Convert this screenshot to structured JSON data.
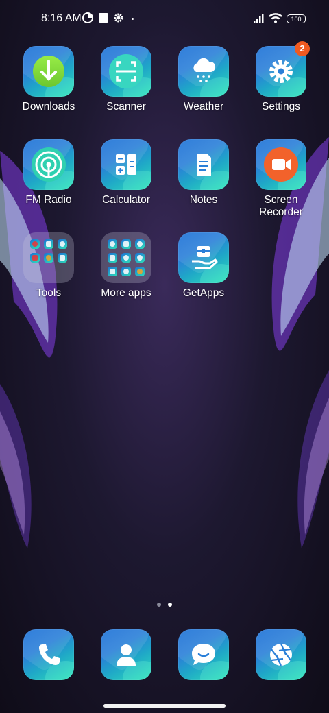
{
  "status_bar": {
    "time": "8:16 AM",
    "battery": "100"
  },
  "apps": [
    {
      "label": "Downloads",
      "icon": "download-icon"
    },
    {
      "label": "Scanner",
      "icon": "scanner-icon"
    },
    {
      "label": "Weather",
      "icon": "weather-cloud-icon"
    },
    {
      "label": "Settings",
      "icon": "gear-icon",
      "badge": "2"
    },
    {
      "label": "FM Radio",
      "icon": "radio-icon"
    },
    {
      "label": "Calculator",
      "icon": "calculator-icon"
    },
    {
      "label": "Notes",
      "icon": "notes-icon"
    },
    {
      "label": "Screen\nRecorder",
      "label_line1": "Screen",
      "label_line2": "Recorder",
      "icon": "video-camera-icon"
    },
    {
      "label": "Tools",
      "icon": "folder-icon"
    },
    {
      "label": "More apps",
      "icon": "folder-icon"
    },
    {
      "label": "GetApps",
      "icon": "getapps-icon"
    }
  ],
  "dock": [
    {
      "name": "phone",
      "icon": "phone-icon"
    },
    {
      "name": "contacts",
      "icon": "contact-icon"
    },
    {
      "name": "messages",
      "icon": "message-icon"
    },
    {
      "name": "camera",
      "icon": "camera-aperture-icon"
    }
  ],
  "pager": {
    "pages": 2,
    "current": 2
  },
  "colors": {
    "badge": "#ef5a21",
    "tile_start": "#1a6fd6",
    "tile_end": "#2de0b8"
  }
}
